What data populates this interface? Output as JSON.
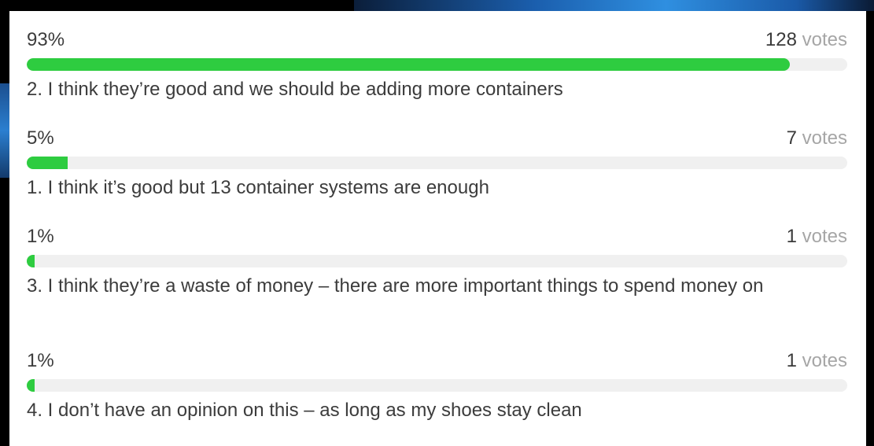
{
  "poll": {
    "options": [
      {
        "percent_label": "93%",
        "votes_count": "128",
        "votes_suffix": "votes",
        "fill": 0.93,
        "text": "2. I think they’re good and we should be adding more containers",
        "bar_color": "#2ecc40"
      },
      {
        "percent_label": "5%",
        "votes_count": "7",
        "votes_suffix": "votes",
        "fill": 0.05,
        "text": "1. I think it’s good but 13 container systems are enough",
        "bar_color": "#2ecc40"
      },
      {
        "percent_label": "1%",
        "votes_count": "1",
        "votes_suffix": "votes",
        "fill": 0.01,
        "text": "3. I think they’re a waste of money – there are more important things to spend money on",
        "bar_color": "#2ecc40"
      },
      {
        "percent_label": "1%",
        "votes_count": "1",
        "votes_suffix": "votes",
        "fill": 0.01,
        "text": "4. I don’t have an opinion on this – as long as my shoes stay clean",
        "bar_color": "#2ecc40"
      }
    ]
  }
}
